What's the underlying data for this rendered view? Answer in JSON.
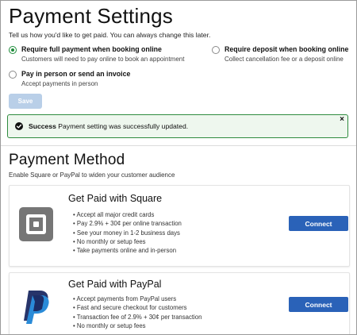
{
  "page": {
    "title": "Payment Settings",
    "intro": "Tell us how you'd like to get paid. You can always change this later."
  },
  "options": [
    {
      "title": "Require full payment when booking online",
      "subtitle": "Customers will need to pay online to book an appointment",
      "selected": true
    },
    {
      "title": "Require deposit when booking online",
      "subtitle": "Collect cancellation fee or a deposit online",
      "selected": false
    },
    {
      "title": "Pay in person or send an invoice",
      "subtitle": "Accept payments in person",
      "selected": false
    }
  ],
  "save_label": "Save",
  "alert": {
    "strong": "Success",
    "message": " Payment setting was successfully updated.",
    "close": "×"
  },
  "payment_method": {
    "title": "Payment Method",
    "subtitle": "Enable Square or PayPal to widen your customer audience"
  },
  "providers": {
    "square": {
      "title": "Get Paid with Square",
      "icon": "square-logo-icon",
      "bullets": [
        "Accept all major credit cards",
        "Pay 2.9% + 30¢ per online transaction",
        "See your money in 1-2 business days",
        "No monthly or setup fees",
        "Take payments online and in-person"
      ],
      "connect_label": "Connect"
    },
    "paypal": {
      "title": "Get Paid with PayPal",
      "icon": "paypal-logo-icon",
      "bullets": [
        "Accept payments from PayPal users",
        "Fast and secure checkout for customers",
        "Transaction fee of 2.9% + 30¢ per transaction",
        "No monthly or setup fees"
      ],
      "connect_label": "Connect"
    }
  },
  "colors": {
    "accent_green": "#1e8c3a",
    "connect_blue": "#2a62b8",
    "save_disabled": "#b9cfe8"
  }
}
